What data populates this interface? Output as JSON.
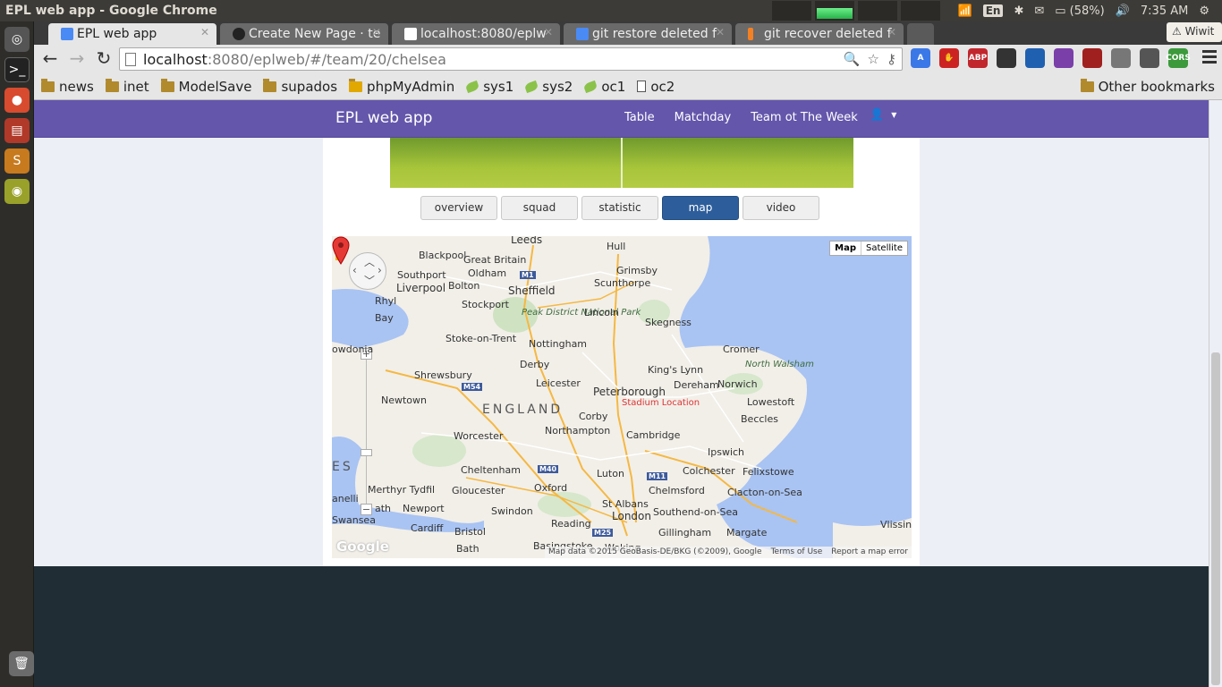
{
  "os": {
    "window_title": "EPL web app - Google Chrome",
    "lang": "En",
    "battery": "(58%)",
    "clock": "7:35 AM"
  },
  "browser": {
    "tabs": [
      {
        "label": "EPL web app",
        "icon": "google-g-icon",
        "active": true
      },
      {
        "label": "Create New Page · te",
        "icon": "github-icon",
        "active": false
      },
      {
        "label": "localhost:8080/eplw",
        "icon": "page-icon",
        "active": false
      },
      {
        "label": "git restore deleted f",
        "icon": "google-g-icon",
        "active": false
      },
      {
        "label": "git recover deleted f",
        "icon": "stackoverflow-icon",
        "active": false
      }
    ],
    "wiwit": "Wiwit",
    "url_host": "localhost",
    "url_rest": ":8080/eplweb/#/team/20/chelsea",
    "bookmarks": [
      {
        "label": "news",
        "icon": "folder"
      },
      {
        "label": "inet",
        "icon": "folder"
      },
      {
        "label": "ModelSave",
        "icon": "folder"
      },
      {
        "label": "supados",
        "icon": "folder"
      },
      {
        "label": "phpMyAdmin",
        "icon": "pma"
      },
      {
        "label": "sys1",
        "icon": "leaf"
      },
      {
        "label": "sys2",
        "icon": "leaf"
      },
      {
        "label": "oc1",
        "icon": "leaf"
      },
      {
        "label": "oc2",
        "icon": "page"
      }
    ],
    "other_bookmarks": "Other bookmarks",
    "extensions": [
      {
        "label": "A",
        "color": "#3b78e7"
      },
      {
        "label": "✋",
        "color": "#cc2222"
      },
      {
        "label": "ABP",
        "color": "#c0262c"
      },
      {
        "label": "",
        "color": "#333333"
      },
      {
        "label": "",
        "color": "#2060b0"
      },
      {
        "label": "",
        "color": "#7a3fa8"
      },
      {
        "label": "",
        "color": "#a02020"
      },
      {
        "label": "",
        "color": "#777777"
      },
      {
        "label": "",
        "color": "#555555"
      },
      {
        "label": "CORS",
        "color": "#3c9a3c"
      }
    ]
  },
  "app": {
    "brand": "EPL web app",
    "nav": [
      "Table",
      "Matchday",
      "Team ot The Week"
    ],
    "team_tabs": [
      {
        "label": "overview",
        "active": false
      },
      {
        "label": "squad",
        "active": false
      },
      {
        "label": "statistic",
        "active": false
      },
      {
        "label": "map",
        "active": true
      },
      {
        "label": "video",
        "active": false
      }
    ]
  },
  "map": {
    "type_map": "Map",
    "type_satellite": "Satellite",
    "marker_label": "Stadium Location",
    "region_label": "ENGLAND",
    "places": [
      "Leeds",
      "Hull",
      "Blackpool",
      "Great Britain",
      "Grimsby",
      "Southport",
      "Oldham",
      "Bolton",
      "Liverpool",
      "Sheffield",
      "Scunthorpe",
      "Rhyl",
      "Stockport",
      "Peak District National Park",
      "Lincoln",
      "Skegness",
      "Bay",
      "Stoke-on-Trent",
      "Nottingham",
      "Cromer",
      "Derby",
      "King's Lynn",
      "North Walsham",
      "Shrewsbury",
      "Leicester",
      "Peterborough",
      "Dereham",
      "Norwich",
      "Newtown",
      "Lowestoft",
      "Corby",
      "Beccles",
      "Worcester",
      "Northampton",
      "Cambridge",
      "Ipswich",
      "Cheltenham",
      "Colchester",
      "Felixstowe",
      "Merthyr Tydfil",
      "Gloucester",
      "Oxford",
      "Luton",
      "Chelmsford",
      "Clacton-on-Sea",
      "Newport",
      "St Albans",
      "Swindon",
      "Swansea",
      "Cardiff",
      "Bristol",
      "Reading",
      "London",
      "Southend-on-Sea",
      "Gillingham",
      "Margate",
      "Basingstoke",
      "Bath",
      "Woking",
      "Vlissing",
      "owdonia",
      "ES",
      "anelli",
      "ath"
    ],
    "roads": [
      "M1",
      "M54",
      "M40",
      "M11",
      "M25"
    ],
    "attribution": [
      "Map data ©2015 GeoBasis-DE/BKG (©2009), Google",
      "Terms of Use",
      "Report a map error"
    ],
    "logo": "Google"
  }
}
